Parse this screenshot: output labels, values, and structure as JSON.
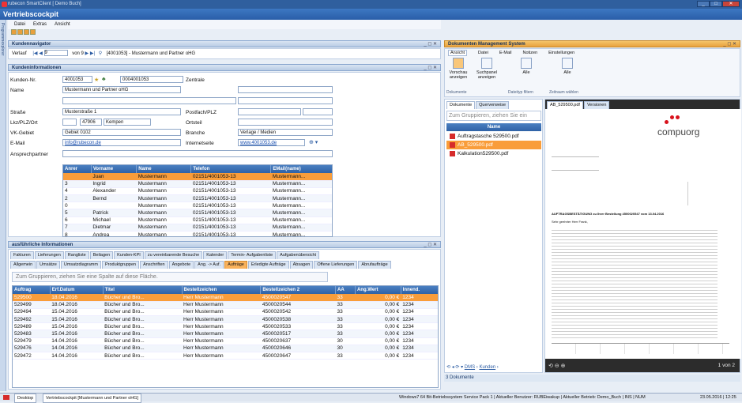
{
  "window": {
    "title": "rubecon SmartClient [ Demo Buch]",
    "controls": [
      "_",
      "□",
      "✕"
    ]
  },
  "app": {
    "header": "Vertriebscockpit",
    "side_tab": "Programmexplorer"
  },
  "menu": [
    "Datei",
    "Extras",
    "Ansicht"
  ],
  "kundennavigator": {
    "title": "Kundennavigator",
    "verlauf": "Verlauf",
    "page": "9",
    "of": "von 9",
    "crumb": "[4001053] - Mustermann und Partner oHG"
  },
  "kundeninfo": {
    "title": "Kundeninformationen",
    "labels": {
      "kundennr": "Kunden-Nr.",
      "zentrale": "Zentrale",
      "name": "Name",
      "strasse": "Straße",
      "postfach": "Postfach/PLZ",
      "lkz": "Lkz/PLZ/Ort",
      "ortsteil": "Ortsteil",
      "vkgebiet": "VK-Gebiet",
      "branche": "Branche",
      "email": "E-Mail",
      "internet": "Internetseite",
      "ansprech": "Ansprechpartner"
    },
    "values": {
      "kundennr": "4001053",
      "kundennr2": "0004001053",
      "name": "Mustermann und Partner oHG",
      "strasse": "Musterstraße 1",
      "plz": "47906",
      "ort": "Kempen",
      "vkgebiet": "Gebiet 0102",
      "branche": "Verlage / Medien",
      "email": "info@rubecon.de",
      "internet": "www.4001053.de"
    },
    "contacts": {
      "headers": [
        "Anrer",
        "Vorname",
        "Name",
        "Telefon",
        "EMail(name)"
      ],
      "rows": [
        [
          "",
          "Juan",
          "Mustermann",
          "02151/4001053-13",
          "Mustermann..."
        ],
        [
          "3",
          "Ingrid",
          "Mustermann",
          "02151/4001053-13",
          "Mustermann..."
        ],
        [
          "4",
          "Alexander",
          "Mustermann",
          "02151/4001053-13",
          "Mustermann..."
        ],
        [
          "2",
          "Bernd",
          "Mustermann",
          "02151/4001053-13",
          "Mustermann..."
        ],
        [
          "0",
          "",
          "Mustermann",
          "02151/4001053-13",
          "Mustermann..."
        ],
        [
          "5",
          "Patrick",
          "Mustermann",
          "02151/4001053-13",
          "Mustermann..."
        ],
        [
          "6",
          "Michael",
          "Mustermann",
          "02151/4001053-13",
          "Mustermann..."
        ],
        [
          "7",
          "Dietmar",
          "Mustermann",
          "02151/4001053-13",
          "Mustermann..."
        ],
        [
          "8",
          "Andrea",
          "Mustermann",
          "02151/4001053-13",
          "Mustermann..."
        ]
      ]
    }
  },
  "details": {
    "title": "ausführliche Informationen",
    "tabs1": [
      "Fakturen",
      "Lieferungen",
      "Rangliste",
      "Beilagen",
      "Kunden-KPI",
      "zu vereinbarende Besuche",
      "Kalender",
      "Termin- Aufgabenliste",
      "Aufgabenübersicht"
    ],
    "tabs2": [
      "Allgemein",
      "Umsätze",
      "Umsatzdiagramm",
      "Produktgruppen",
      "Anschriften",
      "Angebote",
      "Ang. -> Auf.",
      "Aufträge",
      "Erledigte Aufträge",
      "Absagen",
      "Offene Lieferungen",
      "Abrufaufträge"
    ],
    "active_tab2": "Aufträge",
    "group_hint": "Zum Gruppieren, ziehen Sie eine Spalte auf diese Fläche.",
    "headers": [
      "Auftrag",
      "Erf.Datum",
      "Titel",
      "Bestellzeichen",
      "Bestellzeichen 2",
      "AA",
      "Ang.Wert",
      "Innend."
    ],
    "rows": [
      [
        "529500",
        "18.04.2016",
        "Bücher und Bro...",
        "Herr Mustermann",
        "4500020547",
        "33",
        "0,00 €",
        "1234"
      ],
      [
        "529499",
        "18.04.2016",
        "Bücher und Bro...",
        "Herr Mustermann",
        "4500020544",
        "33",
        "0,00 €",
        "1234"
      ],
      [
        "529494",
        "15.04.2016",
        "Bücher und Bro...",
        "Herr Mustermann",
        "4500020542",
        "33",
        "0,00 €",
        "1234"
      ],
      [
        "529492",
        "15.04.2016",
        "Bücher und Bro...",
        "Herr Mustermann",
        "4500020538",
        "33",
        "0,00 €",
        "1234"
      ],
      [
        "529489",
        "15.04.2016",
        "Bücher und Bro...",
        "Herr Mustermann",
        "4500020533",
        "33",
        "0,00 €",
        "1234"
      ],
      [
        "529483",
        "15.04.2016",
        "Bücher und Bro...",
        "Herr Mustermann",
        "4500020517",
        "33",
        "0,00 €",
        "1234"
      ],
      [
        "529479",
        "14.04.2016",
        "Bücher und Bro...",
        "Herr Mustermann",
        "4500020637",
        "30",
        "0,00 €",
        "1234"
      ],
      [
        "529476",
        "14.04.2016",
        "Bücher und Bro...",
        "Herr Mustermann",
        "4500020646",
        "30",
        "0,00 €",
        "1234"
      ],
      [
        "529472",
        "14.04.2016",
        "Bücher und Bro...",
        "Herr Mustermann",
        "4500020647",
        "33",
        "0,00 €",
        "1234"
      ]
    ]
  },
  "dms": {
    "title": "Dokumenten Management System",
    "ribbon_tabs": [
      "Ansicht",
      "Datei",
      "E-Mail",
      "Notizen",
      "Einstellungen"
    ],
    "ribbon_buttons": [
      "Vorschau anzeigen",
      "Suchpanel anzeigen",
      "Alle",
      "Alle"
    ],
    "ribbon_groups": [
      "Dokumente",
      "Dateityp filtern",
      "Zeitraum wählen"
    ],
    "list_tabs": [
      "Dokumente",
      "Querverweise"
    ],
    "group_hint": "Zum Gruppieren, ziehen Sie ein",
    "col_name": "Name",
    "files": [
      "Auftragstasche 529500.pdf",
      "AB_529500.pdf",
      "Kalkulation529500.pdf"
    ],
    "preview_tabs": [
      "AB_529500.pdf",
      "Versionen"
    ],
    "status": "3 Dokumente",
    "path": [
      "DMS",
      "Kunden"
    ],
    "page": "1 von 2",
    "logo": "compuorg",
    "doc_heading": "AUFTRAGSBESTÄTIGUNG zu Ihrer Bestellung 4500020547 vom 13.04.2016",
    "doc_greeting": "Sehr geehrter Herr Frank,"
  },
  "taskbar": {
    "items": [
      "Desktop",
      "Vertriebscockpit [Mustermann und Partner oHG]"
    ],
    "status": "Windows7 64 Bit-Betriebssystem Service Pack 1 | Aktueller Benutzer: RUBEiwakup | Aktueller Betrieb: Demo_Buch | INS | NUM",
    "datetime": "23.05.2016 | 12:25"
  }
}
